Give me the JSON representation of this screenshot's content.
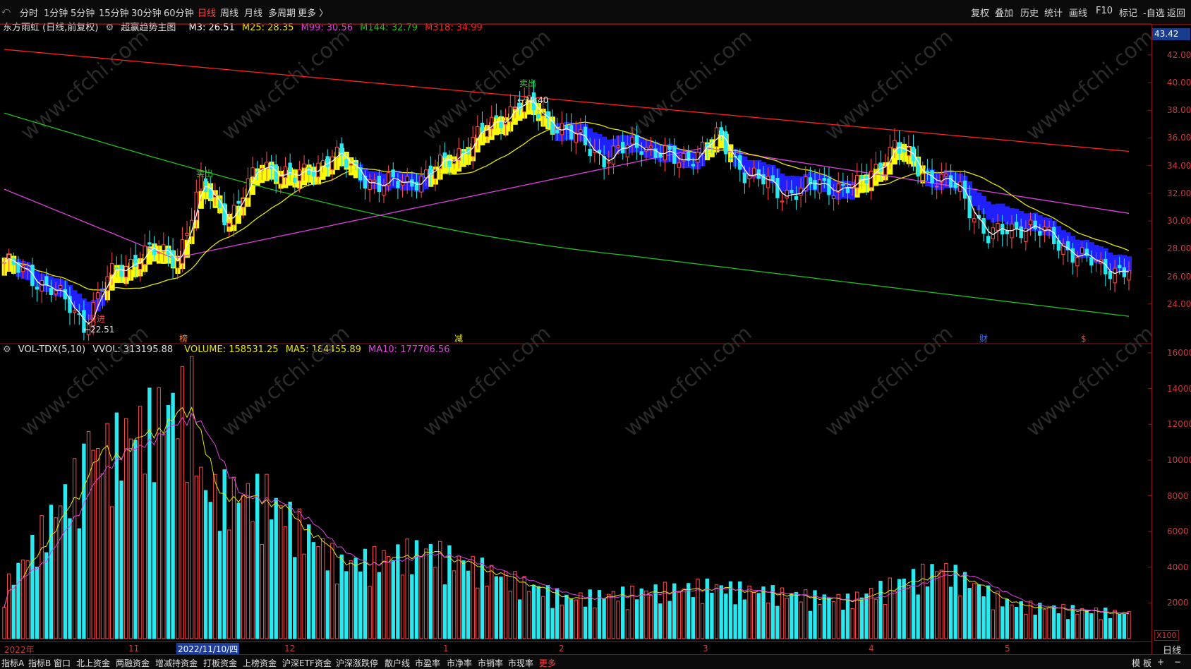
{
  "toolbar": {
    "left_items": [
      "分时",
      "1分钟",
      "5分钟",
      "15分钟",
      "30分钟",
      "60分钟",
      "日线",
      "周线",
      "月线",
      "多周期",
      "更多 〉"
    ],
    "active": "日线",
    "right_items": [
      "复权",
      "叠加",
      "历史",
      "统计",
      "画线",
      "F10",
      "标记",
      "-自选",
      "返回"
    ]
  },
  "info": {
    "stock": "东方雨虹 (日线,前复权)",
    "indicator": "超赢趋势主图",
    "m3": "M3: 26.51",
    "m25": "M25: 28.35",
    "m99": "M99: 30.56",
    "m144": "M144: 32.79",
    "m318": "M318: 34.99"
  },
  "vol_info": {
    "name": "VOL-TDX(5,10)",
    "vvol": "VVOL: 313195.88",
    "volume": "VOLUME: 158531.25",
    "ma5": "MA5: 184455.89",
    "ma10": "MA10: 177706.56"
  },
  "price_tag": "43.42",
  "price_ticks": [
    "42.00",
    "40.00",
    "38.00",
    "36.00",
    "34.00",
    "32.00",
    "30.00",
    "28.00",
    "26.00",
    "24.00"
  ],
  "vol_ticks": [
    "16000",
    "14000",
    "12000",
    "10000",
    "8000",
    "6000",
    "4000",
    "2000"
  ],
  "vol_unit": "X100",
  "dates": {
    "labels": [
      "2022年",
      "11",
      "12",
      "1",
      "2",
      "3",
      "4",
      "5"
    ],
    "cursor": "2022/11/10/四"
  },
  "annotations": {
    "high": "39.40",
    "low": "22.51",
    "buy": "买进",
    "sell1": "卖出",
    "sell2": "卖出",
    "events": [
      "榜",
      "减",
      "财",
      "$"
    ]
  },
  "period": "日线",
  "bottom": {
    "items": [
      "指标A",
      "指标B",
      "窗口",
      "北上资金",
      "两融资金",
      "增减持资金",
      "打板资金",
      "上榜资金",
      "沪深ETF资金",
      "沪深涨跌停",
      "散户线",
      "市盈率",
      "市净率",
      "市销率",
      "市现率",
      "更多"
    ],
    "right": [
      "模",
      "板",
      "+",
      "−"
    ]
  },
  "colors": {
    "up": "#ff4d4d",
    "down": "#28e8f0",
    "m3": "#ffffff",
    "m25": "#e6e600",
    "m99": "#e040e0",
    "m144": "#20c020",
    "m318": "#ff2020",
    "band_up": "#ffff00",
    "band_down": "#2020ff"
  },
  "chart_data": {
    "type": "candlestick",
    "price_ylim": [
      22,
      43.42
    ],
    "vol_ylim": [
      0,
      16000
    ],
    "series": [
      {
        "name": "M3",
        "value": 26.51
      },
      {
        "name": "M25",
        "value": 28.35
      },
      {
        "name": "M99",
        "value": 30.56
      },
      {
        "name": "M144",
        "value": 32.79
      },
      {
        "name": "M318",
        "value": 34.99
      }
    ],
    "ohlc_anchors": [
      {
        "i": 0,
        "c": 27.0
      },
      {
        "i": 10,
        "c": 25.2
      },
      {
        "i": 17,
        "c": 22.6
      },
      {
        "i": 22,
        "c": 25.8
      },
      {
        "i": 30,
        "c": 27.8
      },
      {
        "i": 37,
        "c": 27.4
      },
      {
        "i": 42,
        "c": 32.6
      },
      {
        "i": 48,
        "c": 30.2
      },
      {
        "i": 55,
        "c": 34.2
      },
      {
        "i": 62,
        "c": 33.0
      },
      {
        "i": 70,
        "c": 34.8
      },
      {
        "i": 80,
        "c": 32.5
      },
      {
        "i": 90,
        "c": 33.2
      },
      {
        "i": 100,
        "c": 35.8
      },
      {
        "i": 110,
        "c": 38.6
      },
      {
        "i": 118,
        "c": 36.9
      },
      {
        "i": 128,
        "c": 34.6
      },
      {
        "i": 136,
        "c": 35.6
      },
      {
        "i": 144,
        "c": 34.2
      },
      {
        "i": 152,
        "c": 36.0
      },
      {
        "i": 158,
        "c": 33.6
      },
      {
        "i": 166,
        "c": 32.0
      },
      {
        "i": 174,
        "c": 32.6
      },
      {
        "i": 182,
        "c": 32.4
      },
      {
        "i": 190,
        "c": 35.4
      },
      {
        "i": 196,
        "c": 33.6
      },
      {
        "i": 204,
        "c": 32.2
      },
      {
        "i": 210,
        "c": 28.8
      },
      {
        "i": 218,
        "c": 29.8
      },
      {
        "i": 226,
        "c": 28.2
      },
      {
        "i": 234,
        "c": 26.6
      },
      {
        "i": 240,
        "c": 26.5
      }
    ],
    "volume_anchors": [
      {
        "i": 0,
        "v": 3200
      },
      {
        "i": 18,
        "v": 11500
      },
      {
        "i": 40,
        "v": 15800
      },
      {
        "i": 42,
        "v": 9600
      },
      {
        "i": 56,
        "v": 9200
      },
      {
        "i": 72,
        "v": 4800
      },
      {
        "i": 90,
        "v": 5800
      },
      {
        "i": 120,
        "v": 2600
      },
      {
        "i": 150,
        "v": 3400
      },
      {
        "i": 180,
        "v": 2500
      },
      {
        "i": 200,
        "v": 4600
      },
      {
        "i": 215,
        "v": 2200
      },
      {
        "i": 240,
        "v": 1600
      }
    ],
    "n_bars": 241
  }
}
